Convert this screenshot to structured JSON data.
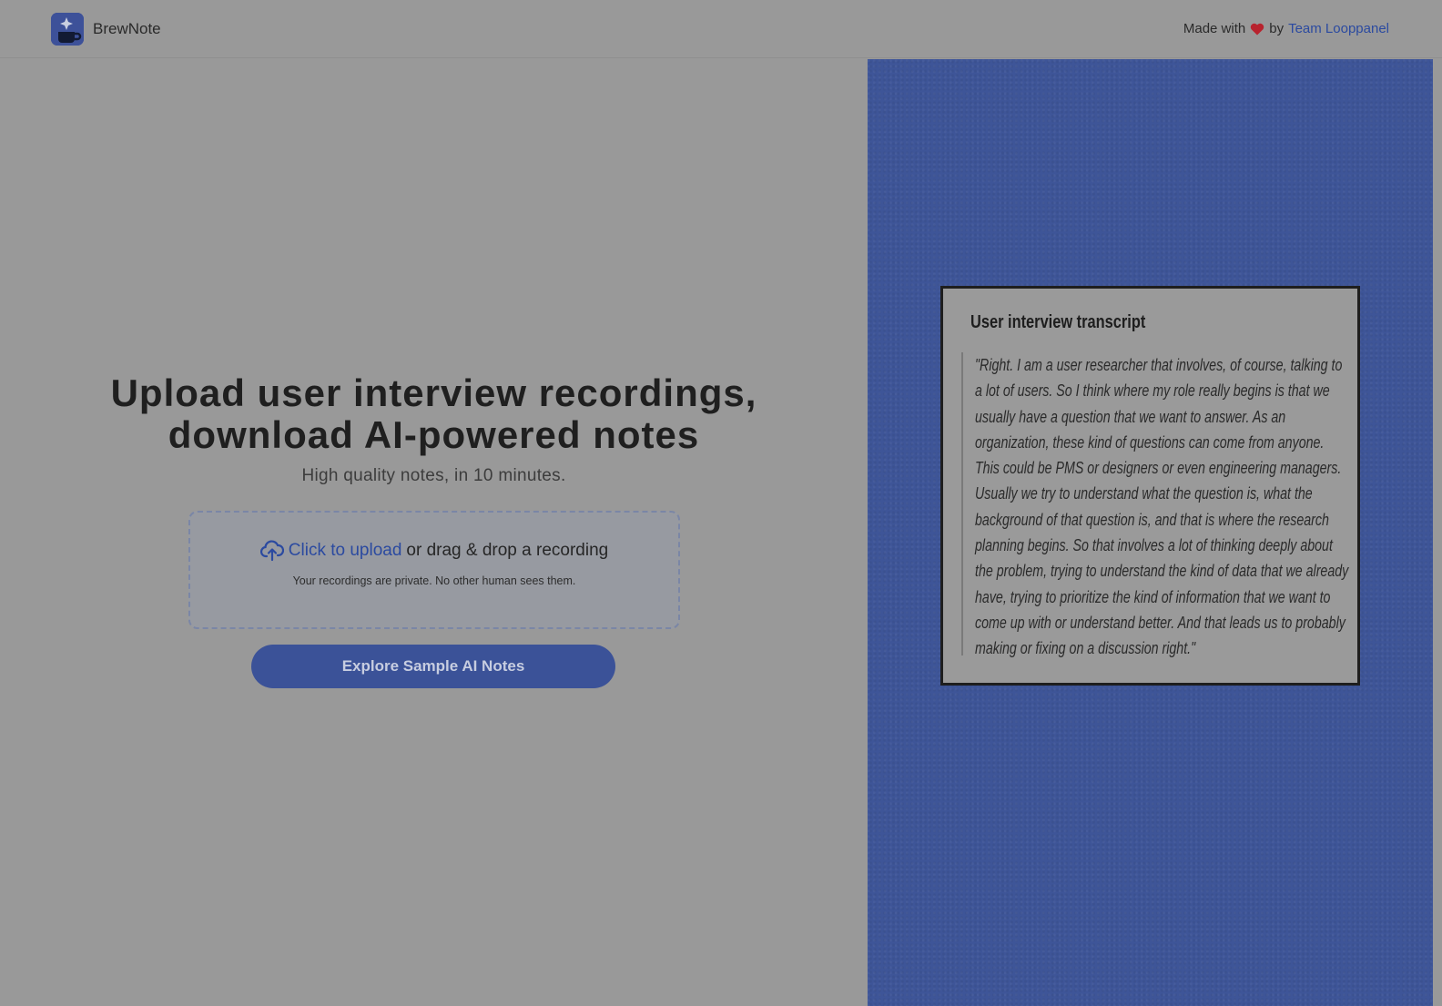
{
  "header": {
    "brand_name": "BrewNote",
    "logo_icon": "brewnote-logo-icon",
    "credit_prefix": "Made with",
    "heart_icon": "heart-icon",
    "credit_by": "by",
    "credit_link": "Team Looppanel"
  },
  "hero": {
    "title_line1": "Upload user interview recordings,",
    "title_line2": "download AI-powered notes",
    "subtitle": "High quality notes, in 10 minutes.",
    "upload": {
      "icon": "cloud-upload-icon",
      "link_label": "Click to upload",
      "rest_label": "or drag & drop a recording",
      "privacy_note": "Your recordings are private. No other human sees them."
    },
    "explore_button": "Explore Sample AI Notes"
  },
  "transcript": {
    "title": "User interview transcript",
    "quote": "\"Right. I am a user researcher that involves, of course, talking to a lot of users. So I think where my role really begins is that we usually have a question that we want to answer. As an organization, these kind of questions can come from anyone. This could be PMS or designers or even engineering managers. Usually we try to understand what the question is, what the background of that question is, and that is where the research planning begins. So that involves a lot of thinking deeply about the problem, trying to understand the kind of data that we already have, trying to prioritize the kind of information that we want to come up with or understand better. And that leads us to probably making or fixing on a discussion right.\""
  },
  "colors": {
    "overlay_gray": "#999999",
    "accent_blue": "#3b5298",
    "link_blue": "#2b4aa0",
    "heart_red": "#b8232e"
  }
}
